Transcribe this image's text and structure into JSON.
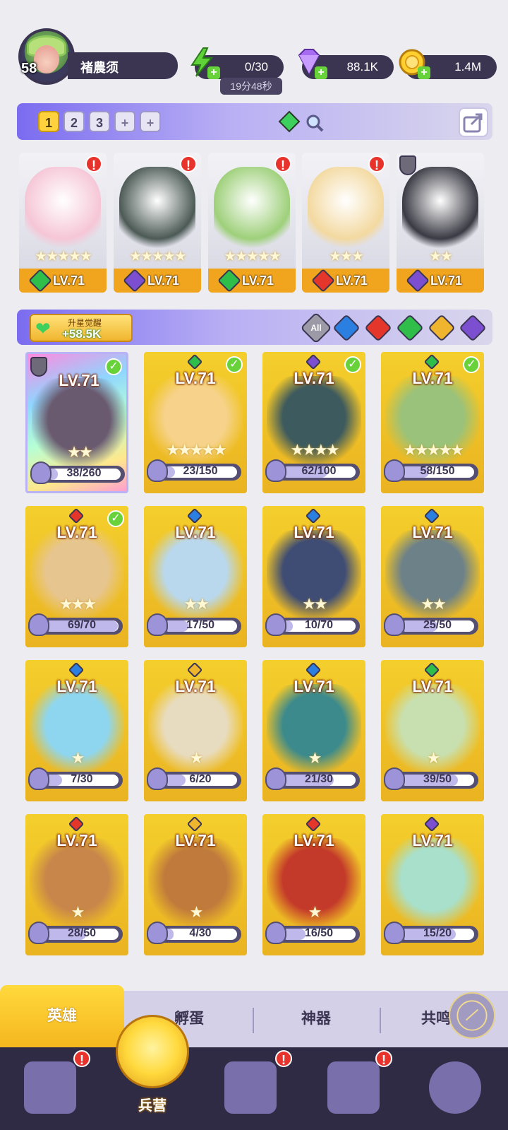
{
  "player": {
    "level": "58",
    "name": "褚農须"
  },
  "resources": {
    "energy": "0/30",
    "energy_timer": "19分48秒",
    "gems": "88.1K",
    "gold": "1.4M"
  },
  "team_tabs": [
    "1",
    "2",
    "3",
    "+",
    "+"
  ],
  "team": [
    {
      "level": "LV.71",
      "stars": "★★★★★",
      "element": "#2fbe4a",
      "art": "#f6c6d6",
      "alert": true
    },
    {
      "level": "LV.71",
      "stars": "★★★★★",
      "element": "#7b4fd0",
      "art": "#4c5a55",
      "alert": true
    },
    {
      "level": "LV.71",
      "stars": "★★★★★",
      "element": "#2fbe4a",
      "art": "#9ed07a",
      "alert": true
    },
    {
      "level": "LV.71",
      "stars": "★★★",
      "element": "#e5362b",
      "art": "#f3d9a0",
      "alert": true
    },
    {
      "level": "LV.71",
      "stars": "★★",
      "element": "#7b4fd0",
      "art": "#3a3a44",
      "alert": false
    }
  ],
  "upstar": {
    "label": "升星觉醒",
    "value": "+58.5K"
  },
  "filter": {
    "all_label": "All",
    "elements": [
      "#2a7fe0",
      "#e5362b",
      "#2fbe4a",
      "#f0b52e",
      "#7b4fd0"
    ]
  },
  "heroes": [
    {
      "level": "LV.71",
      "stars": "★★",
      "fragments": "38/260",
      "progress": 0.146,
      "element": "",
      "check": true,
      "art": "#6a5a70"
    },
    {
      "level": "LV.71",
      "stars": "★★★★★",
      "fragments": "23/150",
      "progress": 0.153,
      "element": "#2fbe4a",
      "check": true,
      "art": "#f6d28a"
    },
    {
      "level": "LV.71",
      "stars": "★★★★",
      "fragments": "62/100",
      "progress": 0.62,
      "element": "#7b4fd0",
      "check": true,
      "art": "#3d5a5e"
    },
    {
      "level": "LV.71",
      "stars": "★★★★★",
      "fragments": "58/150",
      "progress": 0.387,
      "element": "#2fbe4a",
      "check": true,
      "art": "#9ac27a"
    },
    {
      "level": "LV.71",
      "stars": "★★★",
      "fragments": "69/70",
      "progress": 0.986,
      "element": "#e5362b",
      "check": true,
      "art": "#e7c58e"
    },
    {
      "level": "LV.71",
      "stars": "★★",
      "fragments": "17/50",
      "progress": 0.34,
      "element": "#2a7fe0",
      "check": false,
      "art": "#b9d8ee"
    },
    {
      "level": "LV.71",
      "stars": "★★",
      "fragments": "10/70",
      "progress": 0.143,
      "element": "#2a7fe0",
      "check": false,
      "art": "#3f4d74"
    },
    {
      "level": "LV.71",
      "stars": "★★",
      "fragments": "25/50",
      "progress": 0.5,
      "element": "#2a7fe0",
      "check": false,
      "art": "#6d8188"
    },
    {
      "level": "LV.71",
      "stars": "★",
      "fragments": "7/30",
      "progress": 0.233,
      "element": "#2a7fe0",
      "check": false,
      "art": "#8ed6f0"
    },
    {
      "level": "LV.71",
      "stars": "★",
      "fragments": "6/20",
      "progress": 0.3,
      "element": "#f0b52e",
      "check": false,
      "art": "#e8dcc0"
    },
    {
      "level": "LV.71",
      "stars": "★",
      "fragments": "21/30",
      "progress": 0.7,
      "element": "#2a7fe0",
      "check": false,
      "art": "#3c8a8c"
    },
    {
      "level": "LV.71",
      "stars": "★",
      "fragments": "39/50",
      "progress": 0.78,
      "element": "#2fbe4a",
      "check": false,
      "art": "#c8e0b0"
    },
    {
      "level": "LV.71",
      "stars": "★",
      "fragments": "28/50",
      "progress": 0.56,
      "element": "#e5362b",
      "check": false,
      "art": "#c8864a"
    },
    {
      "level": "LV.71",
      "stars": "★",
      "fragments": "4/30",
      "progress": 0.133,
      "element": "#f0b52e",
      "check": false,
      "art": "#c07a3c"
    },
    {
      "level": "LV.71",
      "stars": "★",
      "fragments": "16/50",
      "progress": 0.32,
      "element": "#e5362b",
      "check": false,
      "art": "#c43a2a"
    },
    {
      "level": "LV.71",
      "stars": "",
      "fragments": "15/20",
      "progress": 0.75,
      "element": "#7b4fd0",
      "check": false,
      "art": "#a8e0cc"
    }
  ],
  "subtabs": [
    "英雄",
    "孵蛋",
    "神器",
    "共鸣"
  ],
  "nav": {
    "center_label": "兵营",
    "alerts": [
      true,
      false,
      true,
      true,
      false
    ]
  }
}
